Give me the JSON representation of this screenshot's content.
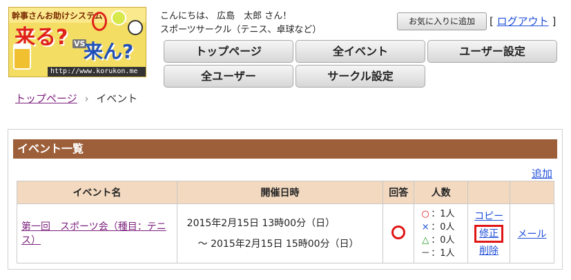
{
  "logo": {
    "tagline": "幹事さんお助けシステム",
    "kuru": "来る?",
    "vs": "VS",
    "kon": "来ん?",
    "url": "http://www.korukon.me"
  },
  "greeting": {
    "line1": "こんにちは、 広島　太郎 さん！",
    "line2": "スポーツサークル（テニス、卓球など）"
  },
  "header": {
    "favorite_label": "お気に入りに追加",
    "logout_open": "[",
    "logout_label": "ログアウト",
    "logout_close": "]"
  },
  "nav": {
    "items": [
      {
        "label": "トップページ"
      },
      {
        "label": "全イベント"
      },
      {
        "label": "ユーザー設定"
      },
      {
        "label": "全ユーザー"
      },
      {
        "label": "サークル設定"
      }
    ]
  },
  "breadcrumb": {
    "home": "トップページ",
    "separator": "›",
    "current": "イベント"
  },
  "panel": {
    "title": "イベント一覧",
    "add_label": "追加",
    "columns": [
      "イベント名",
      "開催日時",
      "回答",
      "人数",
      "",
      ""
    ],
    "rows": [
      {
        "name": "第一回　スポーツ会（種目：テニス）",
        "start": "2015年2月15日 13時00分（日）",
        "end": "～ 2015年2月15日 15時00分（日）",
        "answer_icon": "circle-icon",
        "counts": [
          {
            "symbol": "○",
            "label": "：1人"
          },
          {
            "symbol": "×",
            "label": "：0人"
          },
          {
            "symbol": "△",
            "label": "：0人"
          },
          {
            "symbol": "－",
            "label": "：1人"
          }
        ],
        "actions": {
          "copy": "コピー",
          "edit": "修正",
          "delete": "削除"
        },
        "mail": "メール"
      }
    ]
  },
  "colors": {
    "panel_header": "#9d5f3a",
    "table_header": "#f2d9c0",
    "highlight": "#e01515",
    "link": "#1f4fd8",
    "visited_link": "#7b1f7b"
  }
}
